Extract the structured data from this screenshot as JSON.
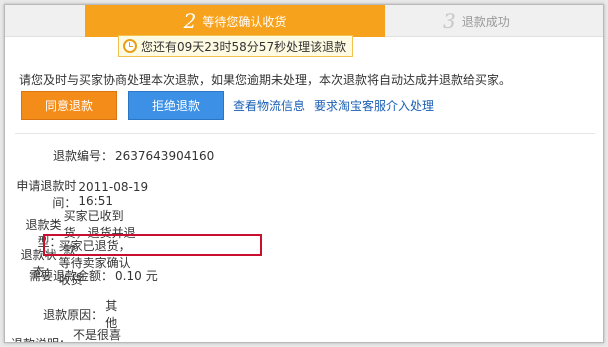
{
  "steps": {
    "current": {
      "num": "2",
      "label": "等待您确认收货"
    },
    "next": {
      "num": "3",
      "label": "退款成功"
    }
  },
  "timer": {
    "text": "您还有09天23时58分57秒处理该退款"
  },
  "notice": "请您及时与买家协商处理本次退款，如果您逾期未处理，本次退款将自动达成并退款给买家。",
  "actions": {
    "agree": "同意退款",
    "refuse": "拒绝退款",
    "logistics": "查看物流信息",
    "service": "要求淘宝客服介入处理"
  },
  "details": [
    {
      "label": "退款编号：",
      "value": "2637643904160"
    },
    {
      "label": "申请退款时间：",
      "value": "2011-08-19 16:51"
    },
    {
      "label": "退款类型：",
      "value": "买家已收到货，退货并退款"
    },
    {
      "label": "退款状态：",
      "value": "买家已退货，等待卖家确认收货"
    },
    {
      "label": "需要退款金额：",
      "value": "0.10",
      "unit": "元"
    },
    {
      "label": "退款原因：",
      "value": "其他"
    },
    {
      "label": "退款说明：",
      "value": "不是很喜欢，想退货"
    }
  ],
  "colors": {
    "step_active": "#f7a21c",
    "agree_button": "#f48c1a",
    "refuse_button": "#3c91e6",
    "link": "#1a5fb4",
    "amount": "#e4600a",
    "highlight_box": "#c8102e"
  }
}
